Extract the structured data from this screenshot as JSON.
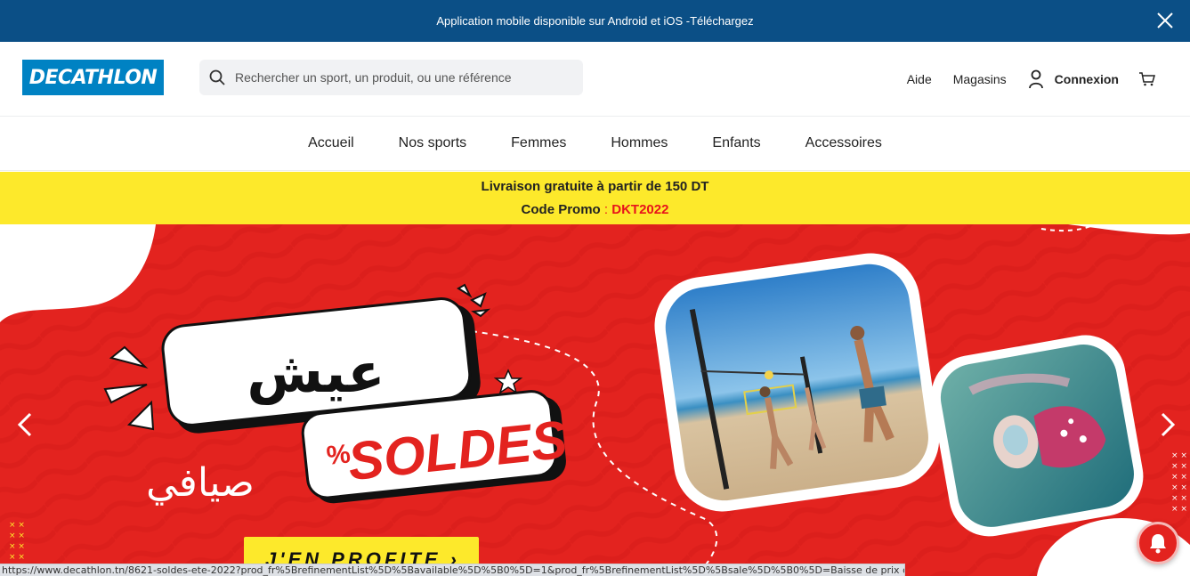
{
  "app_banner": {
    "text": "Application mobile disponible sur Android et iOS -Téléchargez"
  },
  "header": {
    "logo": "DECATHLON",
    "search_placeholder": "Rechercher un sport, un produit, ou une référence",
    "help": "Aide",
    "stores": "Magasins",
    "login": "Connexion"
  },
  "nav": {
    "items": [
      "Accueil",
      "Nos sports",
      "Femmes",
      "Hommes",
      "Enfants",
      "Accessoires"
    ]
  },
  "promo": {
    "line1": "Livraison gratuite à partir de 150 DT",
    "line2_label": "Code Promo",
    "line2_sep": " : ",
    "line2_code": "DKT2022"
  },
  "banner": {
    "arabic_title": "عيش",
    "arabic_subtitle": "صيافي",
    "percent": "%",
    "soldes": "SOLDES",
    "cta": "J'EN PROFITE ›"
  },
  "status_url": "https://www.decathlon.tn/8621-soldes-ete-2022?prod_fr%5BrefinementList%5D%5Bavailable%5D%5B0%5D=1&prod_fr%5BrefinementList%5D%5Bsale%5D%5B0%5D=Baisse de prix définitive",
  "colors": {
    "top_bar": "#0b4f86",
    "brand_blue": "#0082c3",
    "promo_yellow": "#fde92b",
    "promo_code_red": "#e8141b",
    "banner_red": "#e3231f"
  }
}
